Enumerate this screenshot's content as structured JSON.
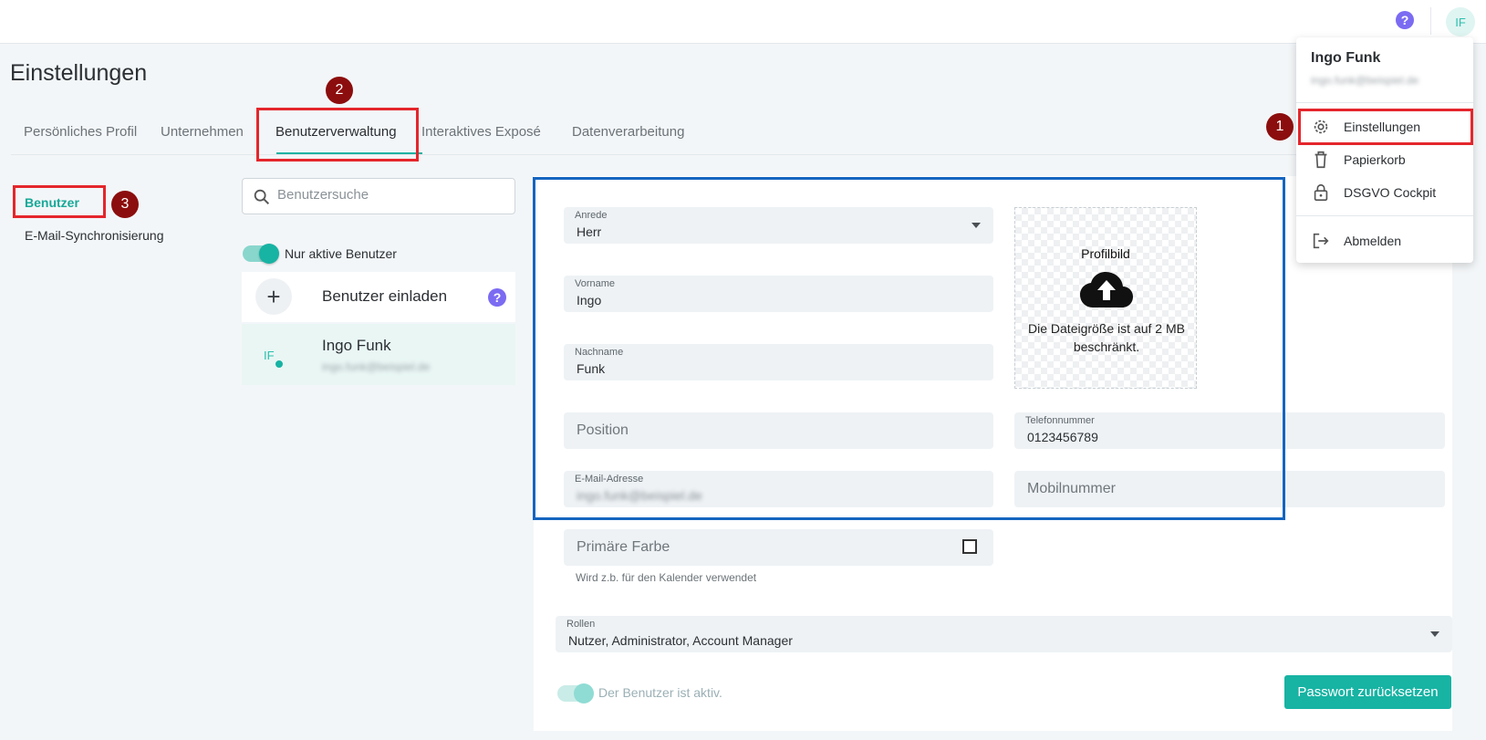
{
  "header": {
    "help_icon": "?",
    "avatar_initials": "IF"
  },
  "page": {
    "title": "Einstellungen"
  },
  "tabs": [
    {
      "label": "Persönliches Profil"
    },
    {
      "label": "Unternehmen"
    },
    {
      "label": "Benutzerverwaltung",
      "active": true
    },
    {
      "label": "Interaktives Exposé"
    },
    {
      "label": "Datenverarbeitung"
    }
  ],
  "sidebar": {
    "items": [
      {
        "label": "Benutzer",
        "active": true
      },
      {
        "label": "E-Mail-Synchronisierung"
      }
    ]
  },
  "annotations": {
    "badge1": "1",
    "badge2": "2",
    "badge3": "3"
  },
  "user_list": {
    "search_placeholder": "Benutzersuche",
    "active_toggle_label": "Nur aktive Benutzer",
    "invite_label": "Benutzer einladen",
    "invite_help": "?",
    "users": [
      {
        "initials": "IF",
        "name": "Ingo Funk",
        "email": "ingo.funk@beispiel.de"
      }
    ]
  },
  "form": {
    "salutation": {
      "label": "Anrede",
      "value": "Herr"
    },
    "first_name": {
      "label": "Vorname",
      "value": "Ingo"
    },
    "last_name": {
      "label": "Nachname",
      "value": "Funk"
    },
    "profile_image": {
      "title": "Profilbild",
      "note": "Die Dateigröße ist auf 2 MB beschränkt."
    },
    "position": {
      "placeholder": "Position"
    },
    "phone": {
      "label": "Telefonnummer",
      "value": "0123456789"
    },
    "email": {
      "label": "E-Mail-Adresse",
      "value": "ingo.funk@beispiel.de"
    },
    "mobile": {
      "placeholder": "Mobilnummer"
    },
    "primary_color": {
      "placeholder": "Primäre Farbe",
      "hint": "Wird z.b. für den Kalender verwendet"
    },
    "roles": {
      "label": "Rollen",
      "value": "Nutzer, Administrator, Account Manager"
    },
    "active_toggle_label": "Der Benutzer ist aktiv.",
    "reset_button": "Passwort zurücksetzen"
  },
  "user_menu": {
    "name": "Ingo Funk",
    "email": "ingo.funk@beispiel.de",
    "items": [
      {
        "label": "Einstellungen",
        "icon": "gear-icon"
      },
      {
        "label": "Papierkorb",
        "icon": "trash-icon"
      },
      {
        "label": "DSGVO Cockpit",
        "icon": "lock-icon"
      },
      {
        "label": "Abmelden",
        "icon": "logout-icon"
      }
    ]
  },
  "colors": {
    "accent": "#17b3a3",
    "highlight_red": "#e4262c",
    "highlight_blue": "#1565c0",
    "badge": "#8c0d0d",
    "help": "#7b6bf2"
  }
}
